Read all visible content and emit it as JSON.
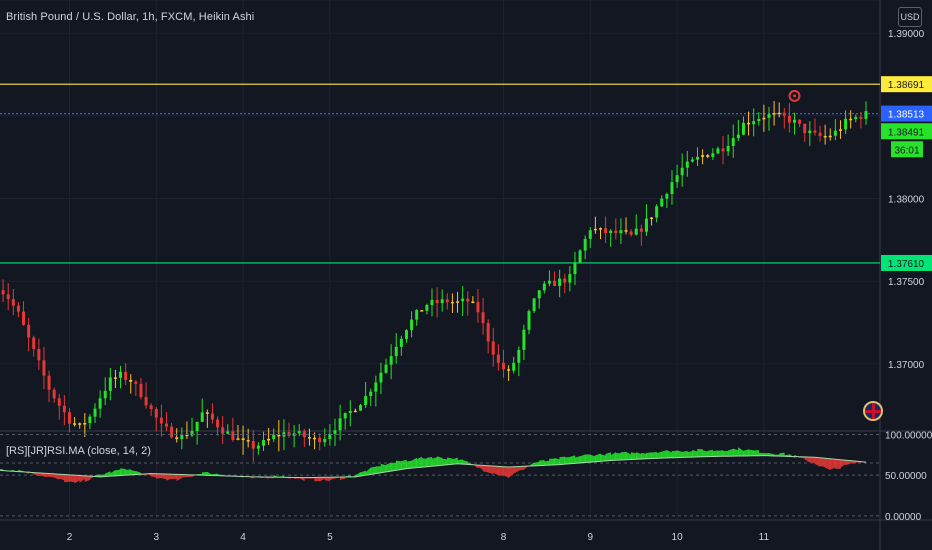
{
  "header": {
    "title": "British Pound / U.S. Dollar, 1h, FXCM, Heikin Ashi",
    "currency_button": "USD"
  },
  "indicator": {
    "title": "[RS][JR]RSI.MA (close, 14, 2)"
  },
  "colors": {
    "background": "#131722",
    "bull": "#26e22b",
    "bear": "#e53935",
    "doji": "#fbc02d",
    "resistance": "#ffeb3b",
    "support": "#00e676",
    "last_price": "#2962ff",
    "grid": "#1e2230"
  },
  "chart_data": [
    {
      "type": "candlestick",
      "title": "British Pound / U.S. Dollar, 1h, FXCM, Heikin Ashi",
      "price_axis": {
        "ticks": [
          1.39,
          1.38,
          1.375,
          1.37
        ],
        "tick_labels": [
          "1.39000",
          "1.38000",
          "1.37500",
          "1.37000"
        ],
        "range": [
          1.366,
          1.392
        ]
      },
      "time_axis": {
        "tick_labels": [
          "2",
          "3",
          "4",
          "5",
          "8",
          "9",
          "10",
          "11"
        ]
      },
      "horizontal_lines": [
        {
          "name": "resistance",
          "value": 1.38691,
          "label": "1.38691",
          "color": "#ffeb3b"
        },
        {
          "name": "last-price",
          "value": 1.38513,
          "label": "1.38513",
          "color": "#2962ff",
          "style": "dotted"
        },
        {
          "name": "support",
          "value": 1.3761,
          "label": "1.37610",
          "color": "#00e676"
        }
      ],
      "price_labels": [
        {
          "name": "current-close",
          "value": 1.38491,
          "label": "1.38491"
        },
        {
          "name": "countdown",
          "label": "36:01"
        }
      ],
      "price_path": [
        [
          0,
          1.3747
        ],
        [
          2,
          1.374
        ],
        [
          4,
          1.373
        ],
        [
          6,
          1.3715
        ],
        [
          8,
          1.37
        ],
        [
          10,
          1.3685
        ],
        [
          12,
          1.3675
        ],
        [
          14,
          1.3666
        ],
        [
          16,
          1.3662
        ],
        [
          18,
          1.3668
        ],
        [
          20,
          1.368
        ],
        [
          22,
          1.369
        ],
        [
          24,
          1.3693
        ],
        [
          26,
          1.369
        ],
        [
          28,
          1.3682
        ],
        [
          30,
          1.3672
        ],
        [
          32,
          1.3662
        ],
        [
          34,
          1.3658
        ],
        [
          36,
          1.3656
        ],
        [
          38,
          1.366
        ],
        [
          40,
          1.367
        ],
        [
          42,
          1.3666
        ],
        [
          44,
          1.366
        ],
        [
          46,
          1.3656
        ],
        [
          48,
          1.3652
        ],
        [
          50,
          1.365
        ],
        [
          52,
          1.3652
        ],
        [
          54,
          1.3656
        ],
        [
          56,
          1.3658
        ],
        [
          58,
          1.3658
        ],
        [
          60,
          1.3656
        ],
        [
          62,
          1.3654
        ],
        [
          64,
          1.3656
        ],
        [
          66,
          1.3662
        ],
        [
          68,
          1.3668
        ],
        [
          70,
          1.3674
        ],
        [
          72,
          1.368
        ],
        [
          74,
          1.369
        ],
        [
          76,
          1.37
        ],
        [
          78,
          1.3712
        ],
        [
          80,
          1.3722
        ],
        [
          82,
          1.373
        ],
        [
          84,
          1.3736
        ],
        [
          86,
          1.3737
        ],
        [
          88,
          1.3738
        ],
        [
          90,
          1.3737
        ],
        [
          92,
          1.3738
        ],
        [
          94,
          1.3732
        ],
        [
          96,
          1.3715
        ],
        [
          98,
          1.37
        ],
        [
          100,
          1.3694
        ],
        [
          102,
          1.3708
        ],
        [
          104,
          1.373
        ],
        [
          106,
          1.3745
        ],
        [
          108,
          1.3748
        ],
        [
          110,
          1.375
        ],
        [
          112,
          1.3752
        ],
        [
          114,
          1.3768
        ],
        [
          116,
          1.3782
        ],
        [
          118,
          1.378
        ],
        [
          120,
          1.3779
        ],
        [
          122,
          1.3779
        ],
        [
          124,
          1.3777
        ],
        [
          126,
          1.3782
        ],
        [
          128,
          1.379
        ],
        [
          130,
          1.38
        ],
        [
          132,
          1.381
        ],
        [
          134,
          1.3818
        ],
        [
          136,
          1.3822
        ],
        [
          138,
          1.3826
        ],
        [
          140,
          1.3828
        ],
        [
          142,
          1.3831
        ],
        [
          144,
          1.3837
        ],
        [
          146,
          1.3845
        ],
        [
          148,
          1.3848
        ],
        [
          150,
          1.385
        ],
        [
          152,
          1.385
        ],
        [
          154,
          1.3849
        ],
        [
          156,
          1.3846
        ],
        [
          158,
          1.3841
        ],
        [
          160,
          1.3838
        ],
        [
          162,
          1.3837
        ],
        [
          164,
          1.384
        ],
        [
          166,
          1.3846
        ],
        [
          168,
          1.3849
        ],
        [
          170,
          1.3851
        ]
      ],
      "marker": {
        "name": "alert-marker",
        "index": 156,
        "value": 1.3862
      }
    },
    {
      "type": "area",
      "title": "[RS][JR]RSI.MA (close, 14, 2)",
      "y_axis": {
        "ticks": [
          100,
          50,
          0
        ],
        "tick_labels": [
          "100.00000",
          "50.00000",
          "0.00000"
        ],
        "range": [
          -5,
          103
        ]
      },
      "reference_lines": [
        100,
        65,
        50,
        0
      ],
      "rsi_path": [
        [
          0,
          58
        ],
        [
          5,
          55
        ],
        [
          10,
          48
        ],
        [
          15,
          40
        ],
        [
          20,
          50
        ],
        [
          25,
          58
        ],
        [
          30,
          48
        ],
        [
          35,
          44
        ],
        [
          40,
          53
        ],
        [
          45,
          50
        ],
        [
          50,
          46
        ],
        [
          55,
          49
        ],
        [
          60,
          45
        ],
        [
          65,
          44
        ],
        [
          70,
          50
        ],
        [
          75,
          62
        ],
        [
          80,
          68
        ],
        [
          85,
          72
        ],
        [
          90,
          70
        ],
        [
          95,
          57
        ],
        [
          100,
          48
        ],
        [
          105,
          65
        ],
        [
          110,
          70
        ],
        [
          115,
          74
        ],
        [
          120,
          76
        ],
        [
          125,
          77
        ],
        [
          130,
          79
        ],
        [
          135,
          80
        ],
        [
          140,
          80
        ],
        [
          145,
          82
        ],
        [
          150,
          78
        ],
        [
          155,
          75
        ],
        [
          160,
          65
        ],
        [
          163,
          56
        ],
        [
          166,
          62
        ],
        [
          170,
          68
        ]
      ],
      "ma_path": [
        [
          0,
          56
        ],
        [
          10,
          52
        ],
        [
          20,
          48
        ],
        [
          30,
          52
        ],
        [
          40,
          50
        ],
        [
          50,
          48
        ],
        [
          60,
          47
        ],
        [
          70,
          48
        ],
        [
          80,
          58
        ],
        [
          90,
          64
        ],
        [
          100,
          60
        ],
        [
          110,
          63
        ],
        [
          120,
          68
        ],
        [
          130,
          71
        ],
        [
          140,
          73
        ],
        [
          150,
          74
        ],
        [
          160,
          72
        ],
        [
          170,
          66
        ]
      ]
    }
  ]
}
